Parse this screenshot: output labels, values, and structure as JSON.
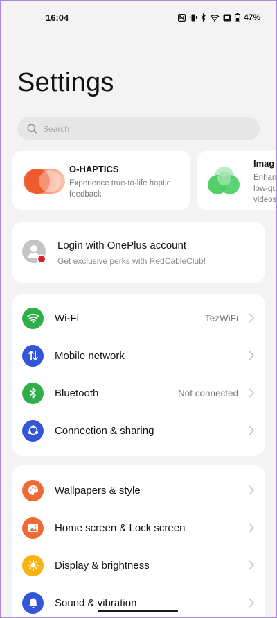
{
  "status_bar": {
    "time": "16:04",
    "battery": "47%"
  },
  "page_title": "Settings",
  "search": {
    "placeholder": "Search"
  },
  "feature_cards": [
    {
      "title": "O-HAPTICS",
      "subtitle_line1": "Experience true-to-life haptic",
      "subtitle_line2": "feedback"
    },
    {
      "title": "Imag",
      "subtitle_line1": "Enhan",
      "subtitle_line2": "low-qu",
      "subtitle_line3": "videos"
    }
  ],
  "account": {
    "title": "Login with OnePlus account",
    "subtitle": "Get exclusive perks with RedCableClub!"
  },
  "connectivity": [
    {
      "label": "Wi-Fi",
      "value": "TezWiFi",
      "color": "#2fae4a",
      "icon": "wifi-icon"
    },
    {
      "label": "Mobile network",
      "value": "",
      "color": "#3355d8",
      "icon": "mobile-data-icon"
    },
    {
      "label": "Bluetooth",
      "value": "Not connected",
      "color": "#2fae4a",
      "icon": "bluetooth-icon"
    },
    {
      "label": "Connection & sharing",
      "value": "",
      "color": "#3355d8",
      "icon": "share-icon"
    }
  ],
  "display": [
    {
      "label": "Wallpapers & style",
      "color": "#ef6a35",
      "icon": "palette-icon"
    },
    {
      "label": "Home screen & Lock screen",
      "color": "#ef6a35",
      "icon": "image-icon"
    },
    {
      "label": "Display & brightness",
      "color": "#f6b311",
      "icon": "sun-icon"
    },
    {
      "label": "Sound & vibration",
      "color": "#3355d8",
      "icon": "bell-icon"
    }
  ]
}
